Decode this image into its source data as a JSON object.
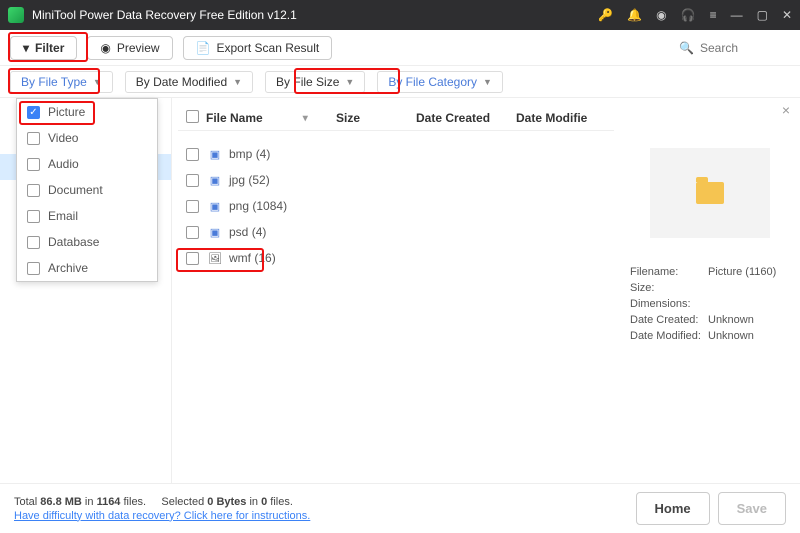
{
  "title": "MiniTool Power Data Recovery Free Edition v12.1",
  "toolbar": {
    "filter": "Filter",
    "preview": "Preview",
    "export": "Export Scan Result"
  },
  "search": {
    "placeholder": "Search"
  },
  "filters": {
    "by_type": "By File Type",
    "by_date": "By Date Modified",
    "by_size": "By File Size",
    "by_cat": "By File Category"
  },
  "dropdown": [
    {
      "label": "Picture",
      "checked": true
    },
    {
      "label": "Video",
      "checked": false
    },
    {
      "label": "Audio",
      "checked": false
    },
    {
      "label": "Document",
      "checked": false
    },
    {
      "label": "Email",
      "checked": false
    },
    {
      "label": "Database",
      "checked": false
    },
    {
      "label": "Archive",
      "checked": false
    }
  ],
  "columns": {
    "name": "File Name",
    "size": "Size",
    "created": "Date Created",
    "modified": "Date Modifie"
  },
  "rows": [
    {
      "name": "bmp",
      "count": "(4)"
    },
    {
      "name": "jpg",
      "count": "(52)"
    },
    {
      "name": "png",
      "count": "(1084)"
    },
    {
      "name": "psd",
      "count": "(4)"
    },
    {
      "name": "wmf",
      "count": "(16)"
    }
  ],
  "preview": {
    "filename_k": "Filename:",
    "filename_v": "Picture (1160)",
    "size_k": "Size:",
    "size_v": "",
    "dim_k": "Dimensions:",
    "dim_v": "",
    "created_k": "Date Created:",
    "created_v": "Unknown",
    "modified_k": "Date Modified:",
    "modified_v": "Unknown"
  },
  "footer": {
    "total_a": "Total ",
    "total_b": "86.8 MB",
    "total_c": " in ",
    "total_d": "1164",
    "total_e": " files.",
    "sel_a": "Selected ",
    "sel_b": "0 Bytes",
    "sel_c": " in ",
    "sel_d": "0",
    "sel_e": " files.",
    "help": "Have difficulty with data recovery? Click here for instructions.",
    "home": "Home",
    "save": "Save"
  }
}
